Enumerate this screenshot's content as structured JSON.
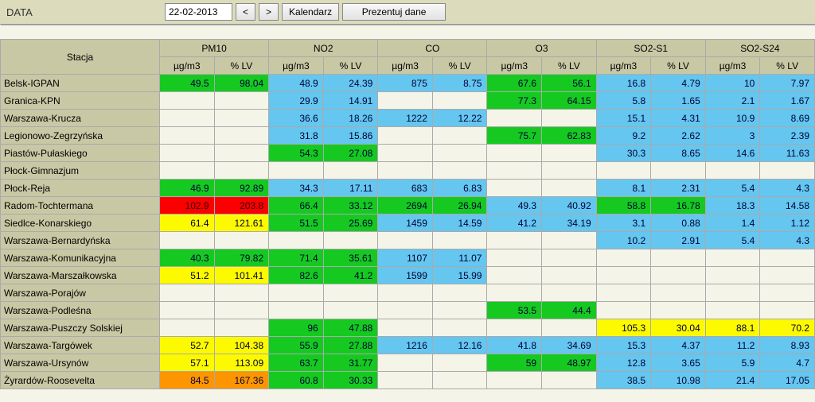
{
  "toolbar": {
    "data_label": "DATA",
    "date_value": "22-02-2013",
    "prev": "<",
    "next": ">",
    "calendar": "Kalendarz",
    "present": "Prezentuj dane"
  },
  "colors": {
    "green": "#16c921",
    "yellow": "#fdfa00",
    "orange": "#fd9500",
    "red": "#fa0000",
    "blue": "#65c6ef",
    "empty": "#f5f4e8"
  },
  "headers": {
    "station": "Stacja",
    "groups": [
      "PM10",
      "NO2",
      "CO",
      "O3",
      "SO2-S1",
      "SO2-S24"
    ],
    "sub": [
      "µg/m3",
      "% LV"
    ]
  },
  "rows": [
    {
      "name": "Belsk-IGPAN",
      "cells": [
        {
          "v": "49.5",
          "c": "green"
        },
        {
          "v": "98.04",
          "c": "green"
        },
        {
          "v": "48.9",
          "c": "blue"
        },
        {
          "v": "24.39",
          "c": "blue"
        },
        {
          "v": "875",
          "c": "blue"
        },
        {
          "v": "8.75",
          "c": "blue"
        },
        {
          "v": "67.6",
          "c": "green"
        },
        {
          "v": "56.1",
          "c": "green"
        },
        {
          "v": "16.8",
          "c": "blue"
        },
        {
          "v": "4.79",
          "c": "blue"
        },
        {
          "v": "10",
          "c": "blue"
        },
        {
          "v": "7.97",
          "c": "blue"
        }
      ]
    },
    {
      "name": "Granica-KPN",
      "cells": [
        {
          "v": "",
          "c": "empty"
        },
        {
          "v": "",
          "c": "empty"
        },
        {
          "v": "29.9",
          "c": "blue"
        },
        {
          "v": "14.91",
          "c": "blue"
        },
        {
          "v": "",
          "c": "empty"
        },
        {
          "v": "",
          "c": "empty"
        },
        {
          "v": "77.3",
          "c": "green"
        },
        {
          "v": "64.15",
          "c": "green"
        },
        {
          "v": "5.8",
          "c": "blue"
        },
        {
          "v": "1.65",
          "c": "blue"
        },
        {
          "v": "2.1",
          "c": "blue"
        },
        {
          "v": "1.67",
          "c": "blue"
        }
      ]
    },
    {
      "name": "Warszawa-Krucza",
      "cells": [
        {
          "v": "",
          "c": "empty"
        },
        {
          "v": "",
          "c": "empty"
        },
        {
          "v": "36.6",
          "c": "blue"
        },
        {
          "v": "18.26",
          "c": "blue"
        },
        {
          "v": "1222",
          "c": "blue"
        },
        {
          "v": "12.22",
          "c": "blue"
        },
        {
          "v": "",
          "c": "empty"
        },
        {
          "v": "",
          "c": "empty"
        },
        {
          "v": "15.1",
          "c": "blue"
        },
        {
          "v": "4.31",
          "c": "blue"
        },
        {
          "v": "10.9",
          "c": "blue"
        },
        {
          "v": "8.69",
          "c": "blue"
        }
      ]
    },
    {
      "name": "Legionowo-Zegrzyńska",
      "cells": [
        {
          "v": "",
          "c": "empty"
        },
        {
          "v": "",
          "c": "empty"
        },
        {
          "v": "31.8",
          "c": "blue"
        },
        {
          "v": "15.86",
          "c": "blue"
        },
        {
          "v": "",
          "c": "empty"
        },
        {
          "v": "",
          "c": "empty"
        },
        {
          "v": "75.7",
          "c": "green"
        },
        {
          "v": "62.83",
          "c": "green"
        },
        {
          "v": "9.2",
          "c": "blue"
        },
        {
          "v": "2.62",
          "c": "blue"
        },
        {
          "v": "3",
          "c": "blue"
        },
        {
          "v": "2.39",
          "c": "blue"
        }
      ]
    },
    {
      "name": "Piastów-Pułaskiego",
      "cells": [
        {
          "v": "",
          "c": "empty"
        },
        {
          "v": "",
          "c": "empty"
        },
        {
          "v": "54.3",
          "c": "green"
        },
        {
          "v": "27.08",
          "c": "green"
        },
        {
          "v": "",
          "c": "empty"
        },
        {
          "v": "",
          "c": "empty"
        },
        {
          "v": "",
          "c": "empty"
        },
        {
          "v": "",
          "c": "empty"
        },
        {
          "v": "30.3",
          "c": "blue"
        },
        {
          "v": "8.65",
          "c": "blue"
        },
        {
          "v": "14.6",
          "c": "blue"
        },
        {
          "v": "11.63",
          "c": "blue"
        }
      ]
    },
    {
      "name": "Płock-Gimnazjum",
      "cells": [
        {
          "v": "",
          "c": "empty"
        },
        {
          "v": "",
          "c": "empty"
        },
        {
          "v": "",
          "c": "empty"
        },
        {
          "v": "",
          "c": "empty"
        },
        {
          "v": "",
          "c": "empty"
        },
        {
          "v": "",
          "c": "empty"
        },
        {
          "v": "",
          "c": "empty"
        },
        {
          "v": "",
          "c": "empty"
        },
        {
          "v": "",
          "c": "empty"
        },
        {
          "v": "",
          "c": "empty"
        },
        {
          "v": "",
          "c": "empty"
        },
        {
          "v": "",
          "c": "empty"
        }
      ]
    },
    {
      "name": "Płock-Reja",
      "cells": [
        {
          "v": "46.9",
          "c": "green"
        },
        {
          "v": "92.89",
          "c": "green"
        },
        {
          "v": "34.3",
          "c": "blue"
        },
        {
          "v": "17.11",
          "c": "blue"
        },
        {
          "v": "683",
          "c": "blue"
        },
        {
          "v": "6.83",
          "c": "blue"
        },
        {
          "v": "",
          "c": "empty"
        },
        {
          "v": "",
          "c": "empty"
        },
        {
          "v": "8.1",
          "c": "blue"
        },
        {
          "v": "2.31",
          "c": "blue"
        },
        {
          "v": "5.4",
          "c": "blue"
        },
        {
          "v": "4.3",
          "c": "blue"
        }
      ]
    },
    {
      "name": "Radom-Tochtermana",
      "cells": [
        {
          "v": "102.9",
          "c": "red"
        },
        {
          "v": "203.8",
          "c": "red"
        },
        {
          "v": "66.4",
          "c": "green"
        },
        {
          "v": "33.12",
          "c": "green"
        },
        {
          "v": "2694",
          "c": "green"
        },
        {
          "v": "26.94",
          "c": "green"
        },
        {
          "v": "49.3",
          "c": "blue"
        },
        {
          "v": "40.92",
          "c": "blue"
        },
        {
          "v": "58.8",
          "c": "green"
        },
        {
          "v": "16.78",
          "c": "green"
        },
        {
          "v": "18.3",
          "c": "blue"
        },
        {
          "v": "14.58",
          "c": "blue"
        }
      ]
    },
    {
      "name": "Siedlce-Konarskiego",
      "cells": [
        {
          "v": "61.4",
          "c": "yellow"
        },
        {
          "v": "121.61",
          "c": "yellow"
        },
        {
          "v": "51.5",
          "c": "green"
        },
        {
          "v": "25.69",
          "c": "green"
        },
        {
          "v": "1459",
          "c": "blue"
        },
        {
          "v": "14.59",
          "c": "blue"
        },
        {
          "v": "41.2",
          "c": "blue"
        },
        {
          "v": "34.19",
          "c": "blue"
        },
        {
          "v": "3.1",
          "c": "blue"
        },
        {
          "v": "0.88",
          "c": "blue"
        },
        {
          "v": "1.4",
          "c": "blue"
        },
        {
          "v": "1.12",
          "c": "blue"
        }
      ]
    },
    {
      "name": "Warszawa-Bernardyńska",
      "cells": [
        {
          "v": "",
          "c": "empty"
        },
        {
          "v": "",
          "c": "empty"
        },
        {
          "v": "",
          "c": "empty"
        },
        {
          "v": "",
          "c": "empty"
        },
        {
          "v": "",
          "c": "empty"
        },
        {
          "v": "",
          "c": "empty"
        },
        {
          "v": "",
          "c": "empty"
        },
        {
          "v": "",
          "c": "empty"
        },
        {
          "v": "10.2",
          "c": "blue"
        },
        {
          "v": "2.91",
          "c": "blue"
        },
        {
          "v": "5.4",
          "c": "blue"
        },
        {
          "v": "4.3",
          "c": "blue"
        }
      ]
    },
    {
      "name": "Warszawa-Komunikacyjna",
      "cells": [
        {
          "v": "40.3",
          "c": "green"
        },
        {
          "v": "79.82",
          "c": "green"
        },
        {
          "v": "71.4",
          "c": "green"
        },
        {
          "v": "35.61",
          "c": "green"
        },
        {
          "v": "1107",
          "c": "blue"
        },
        {
          "v": "11.07",
          "c": "blue"
        },
        {
          "v": "",
          "c": "empty"
        },
        {
          "v": "",
          "c": "empty"
        },
        {
          "v": "",
          "c": "empty"
        },
        {
          "v": "",
          "c": "empty"
        },
        {
          "v": "",
          "c": "empty"
        },
        {
          "v": "",
          "c": "empty"
        }
      ]
    },
    {
      "name": "Warszawa-Marszałkowska",
      "cells": [
        {
          "v": "51.2",
          "c": "yellow"
        },
        {
          "v": "101.41",
          "c": "yellow"
        },
        {
          "v": "82.6",
          "c": "green"
        },
        {
          "v": "41.2",
          "c": "green"
        },
        {
          "v": "1599",
          "c": "blue"
        },
        {
          "v": "15.99",
          "c": "blue"
        },
        {
          "v": "",
          "c": "empty"
        },
        {
          "v": "",
          "c": "empty"
        },
        {
          "v": "",
          "c": "empty"
        },
        {
          "v": "",
          "c": "empty"
        },
        {
          "v": "",
          "c": "empty"
        },
        {
          "v": "",
          "c": "empty"
        }
      ]
    },
    {
      "name": "Warszawa-Porajów",
      "cells": [
        {
          "v": "",
          "c": "empty"
        },
        {
          "v": "",
          "c": "empty"
        },
        {
          "v": "",
          "c": "empty"
        },
        {
          "v": "",
          "c": "empty"
        },
        {
          "v": "",
          "c": "empty"
        },
        {
          "v": "",
          "c": "empty"
        },
        {
          "v": "",
          "c": "empty"
        },
        {
          "v": "",
          "c": "empty"
        },
        {
          "v": "",
          "c": "empty"
        },
        {
          "v": "",
          "c": "empty"
        },
        {
          "v": "",
          "c": "empty"
        },
        {
          "v": "",
          "c": "empty"
        }
      ]
    },
    {
      "name": "Warszawa-Podleśna",
      "cells": [
        {
          "v": "",
          "c": "empty"
        },
        {
          "v": "",
          "c": "empty"
        },
        {
          "v": "",
          "c": "empty"
        },
        {
          "v": "",
          "c": "empty"
        },
        {
          "v": "",
          "c": "empty"
        },
        {
          "v": "",
          "c": "empty"
        },
        {
          "v": "53.5",
          "c": "green"
        },
        {
          "v": "44.4",
          "c": "green"
        },
        {
          "v": "",
          "c": "empty"
        },
        {
          "v": "",
          "c": "empty"
        },
        {
          "v": "",
          "c": "empty"
        },
        {
          "v": "",
          "c": "empty"
        }
      ]
    },
    {
      "name": "Warszawa-Puszczy Solskiej",
      "cells": [
        {
          "v": "",
          "c": "empty"
        },
        {
          "v": "",
          "c": "empty"
        },
        {
          "v": "96",
          "c": "green"
        },
        {
          "v": "47.88",
          "c": "green"
        },
        {
          "v": "",
          "c": "empty"
        },
        {
          "v": "",
          "c": "empty"
        },
        {
          "v": "",
          "c": "empty"
        },
        {
          "v": "",
          "c": "empty"
        },
        {
          "v": "105.3",
          "c": "yellow"
        },
        {
          "v": "30.04",
          "c": "yellow"
        },
        {
          "v": "88.1",
          "c": "yellow"
        },
        {
          "v": "70.2",
          "c": "yellow"
        }
      ]
    },
    {
      "name": "Warszawa-Targówek",
      "cells": [
        {
          "v": "52.7",
          "c": "yellow"
        },
        {
          "v": "104.38",
          "c": "yellow"
        },
        {
          "v": "55.9",
          "c": "green"
        },
        {
          "v": "27.88",
          "c": "green"
        },
        {
          "v": "1216",
          "c": "blue"
        },
        {
          "v": "12.16",
          "c": "blue"
        },
        {
          "v": "41.8",
          "c": "blue"
        },
        {
          "v": "34.69",
          "c": "blue"
        },
        {
          "v": "15.3",
          "c": "blue"
        },
        {
          "v": "4.37",
          "c": "blue"
        },
        {
          "v": "11.2",
          "c": "blue"
        },
        {
          "v": "8.93",
          "c": "blue"
        }
      ]
    },
    {
      "name": "Warszawa-Ursynów",
      "cells": [
        {
          "v": "57.1",
          "c": "yellow"
        },
        {
          "v": "113.09",
          "c": "yellow"
        },
        {
          "v": "63.7",
          "c": "green"
        },
        {
          "v": "31.77",
          "c": "green"
        },
        {
          "v": "",
          "c": "empty"
        },
        {
          "v": "",
          "c": "empty"
        },
        {
          "v": "59",
          "c": "green"
        },
        {
          "v": "48.97",
          "c": "green"
        },
        {
          "v": "12.8",
          "c": "blue"
        },
        {
          "v": "3.65",
          "c": "blue"
        },
        {
          "v": "5.9",
          "c": "blue"
        },
        {
          "v": "4.7",
          "c": "blue"
        }
      ]
    },
    {
      "name": "Żyrardów-Roosevelta",
      "cells": [
        {
          "v": "84.5",
          "c": "orange"
        },
        {
          "v": "167.36",
          "c": "orange"
        },
        {
          "v": "60.8",
          "c": "green"
        },
        {
          "v": "30.33",
          "c": "green"
        },
        {
          "v": "",
          "c": "empty"
        },
        {
          "v": "",
          "c": "empty"
        },
        {
          "v": "",
          "c": "empty"
        },
        {
          "v": "",
          "c": "empty"
        },
        {
          "v": "38.5",
          "c": "blue"
        },
        {
          "v": "10.98",
          "c": "blue"
        },
        {
          "v": "21.4",
          "c": "blue"
        },
        {
          "v": "17.05",
          "c": "blue"
        }
      ]
    }
  ]
}
